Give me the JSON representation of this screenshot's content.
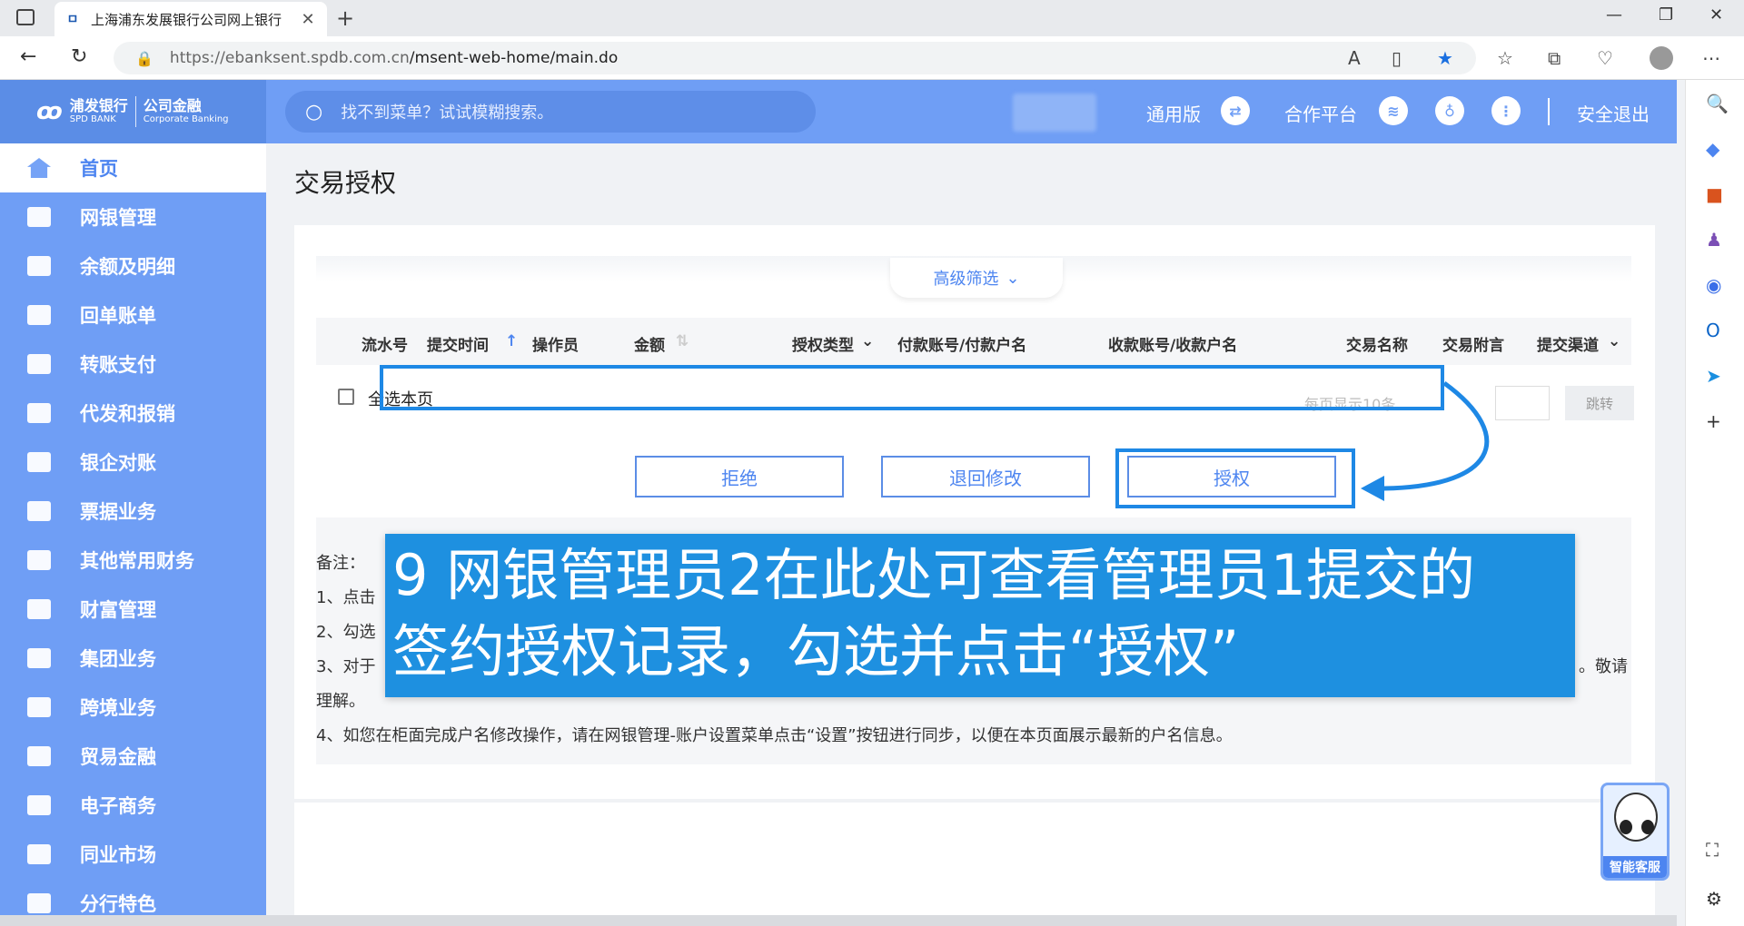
{
  "browser": {
    "tab_title": "上海浦东发展银行公司网上银行",
    "tab_favicon": "spdb-favicon",
    "url_host": "https://ebanksent.spdb.com.cn",
    "url_path": "/msent-web-home/main.do"
  },
  "header": {
    "brand_cn": "浦发银行",
    "brand_en": "SPD BANK",
    "brand_sub_cn": "公司金融",
    "brand_sub_en": "Corporate Banking",
    "search_placeholder": "找不到菜单？试试模糊搜索。",
    "link_general": "通用版",
    "link_partner": "合作平台",
    "link_logout": "安全退出"
  },
  "sidebar": {
    "items": [
      {
        "label": "首页",
        "icon": "home-icon"
      },
      {
        "label": "网银管理",
        "icon": "monitor-icon"
      },
      {
        "label": "余额及明细",
        "icon": "ledger-icon"
      },
      {
        "label": "回单账单",
        "icon": "receipt-icon"
      },
      {
        "label": "转账支付",
        "icon": "transfer-icon"
      },
      {
        "label": "代发和报销",
        "icon": "payroll-icon"
      },
      {
        "label": "银企对账",
        "icon": "reconcile-icon"
      },
      {
        "label": "票据业务",
        "icon": "bill-icon"
      },
      {
        "label": "其他常用财务",
        "icon": "grid-icon"
      },
      {
        "label": "财富管理",
        "icon": "chart-icon"
      },
      {
        "label": "集团业务",
        "icon": "building-icon"
      },
      {
        "label": "跨境业务",
        "icon": "crossborder-icon"
      },
      {
        "label": "贸易金融",
        "icon": "trade-icon"
      },
      {
        "label": "电子商务",
        "icon": "cart-icon"
      },
      {
        "label": "同业市场",
        "icon": "handshake-icon"
      },
      {
        "label": "分行特色",
        "icon": "branch-icon"
      }
    ]
  },
  "main": {
    "page_title": "交易授权",
    "filter_label": "高级筛选",
    "columns": [
      "流水号",
      "提交时间",
      "操作员",
      "金额",
      "授权类型",
      "付款账号/付款户名",
      "收款账号/收款户名",
      "交易名称",
      "交易附言",
      "提交渠道"
    ],
    "select_all": "全选本页",
    "pager_text": "每页显示10条",
    "jump_label": "跳转",
    "btn_reject": "拒绝",
    "btn_return": "退回修改",
    "btn_authorize": "授权",
    "notes": {
      "title": "备注：",
      "line1": "1、点击",
      "line2": "2、勾选",
      "line3_start": "3、对于",
      "line3_end": "。敬请",
      "line3_cont": "理解。",
      "line4": "4、如您在柜面完成户名修改操作，请在网银管理-账户设置菜单点击“设置”按钮进行同步，以便在本页面展示最新的户名信息。"
    }
  },
  "callout": {
    "line1": "9 网银管理员2在此处可查看管理员1提交的",
    "line2": "签约授权记录，勾选并点击“授权”"
  },
  "assistant_label": "智能客服",
  "colors": {
    "brand_blue": "#6f9ef5",
    "accent_blue": "#4d85f0",
    "callout_blue": "#1e90e0"
  }
}
